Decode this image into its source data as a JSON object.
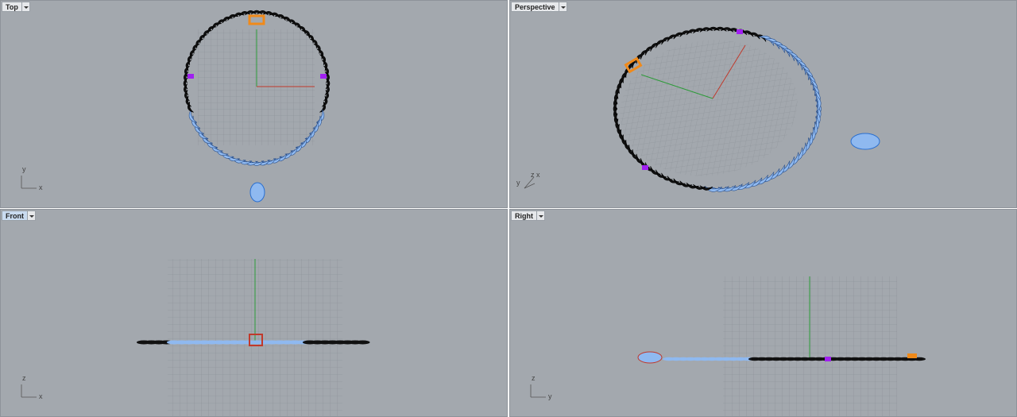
{
  "viewports": {
    "top": {
      "title": "Top",
      "axis_v": "y",
      "axis_h": "x"
    },
    "perspective": {
      "title": "Perspective",
      "axis_a": "y",
      "axis_b": "z",
      "axis_c": "x"
    },
    "front": {
      "title": "Front",
      "axis_v": "z",
      "axis_h": "x"
    },
    "right": {
      "title": "Right",
      "axis_v": "z",
      "axis_h": "y"
    }
  },
  "colors": {
    "viewport_bg": "#a3a8ae",
    "grid_line": "#8a8f95",
    "x_axis": "#c0392b",
    "y_axis": "#2e9b3a",
    "link_dark": "#111111",
    "link_selected": "#8fb9f0",
    "clasp": "#f08a1a",
    "marker": "#a020f0"
  }
}
